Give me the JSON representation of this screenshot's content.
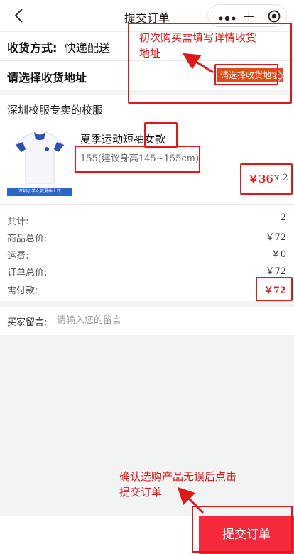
{
  "nav": {
    "title": "提交订单",
    "back_icon": "chevron-left-icon",
    "more_icon": "more-dots-icon",
    "minimize_icon": "minimize-icon",
    "close_icon": "target-circle-icon"
  },
  "shipping": {
    "label": "收货方式:",
    "value": "快递配送"
  },
  "address": {
    "label": "请选择收货地址",
    "button": "请选择收货地址",
    "arrow_icon": "chevron-right-icon"
  },
  "shop": {
    "name": "深圳校服专卖的校服"
  },
  "product": {
    "title": "夏季运动短袖女款",
    "spec": "155(建议身高145~155cm)",
    "price": "￥36",
    "qty": "x 2",
    "image_caption": "深圳小学女款夏季上衣"
  },
  "summary": [
    {
      "label": "共计:",
      "value": "2"
    },
    {
      "label": "商品总价:",
      "value": "￥72"
    },
    {
      "label": "运费:",
      "value": "￥0"
    },
    {
      "label": "订单总价:",
      "value": "￥72"
    },
    {
      "label": "需付款:",
      "value": "￥72"
    }
  ],
  "message": {
    "label": "买家留言:",
    "placeholder": "请输入您的留言"
  },
  "footer": {
    "submit": "提交订单"
  },
  "annotations": {
    "address_note_line1": "初次购买需填写详情收货",
    "address_note_line2": "地址",
    "submit_note_line1": "确认选购产品无误后点击",
    "submit_note_line2": "提交订单"
  },
  "colors": {
    "accent": "#f5283c",
    "address_button": "#e14b18",
    "price": "#e02020",
    "annotation": "#e01818"
  }
}
